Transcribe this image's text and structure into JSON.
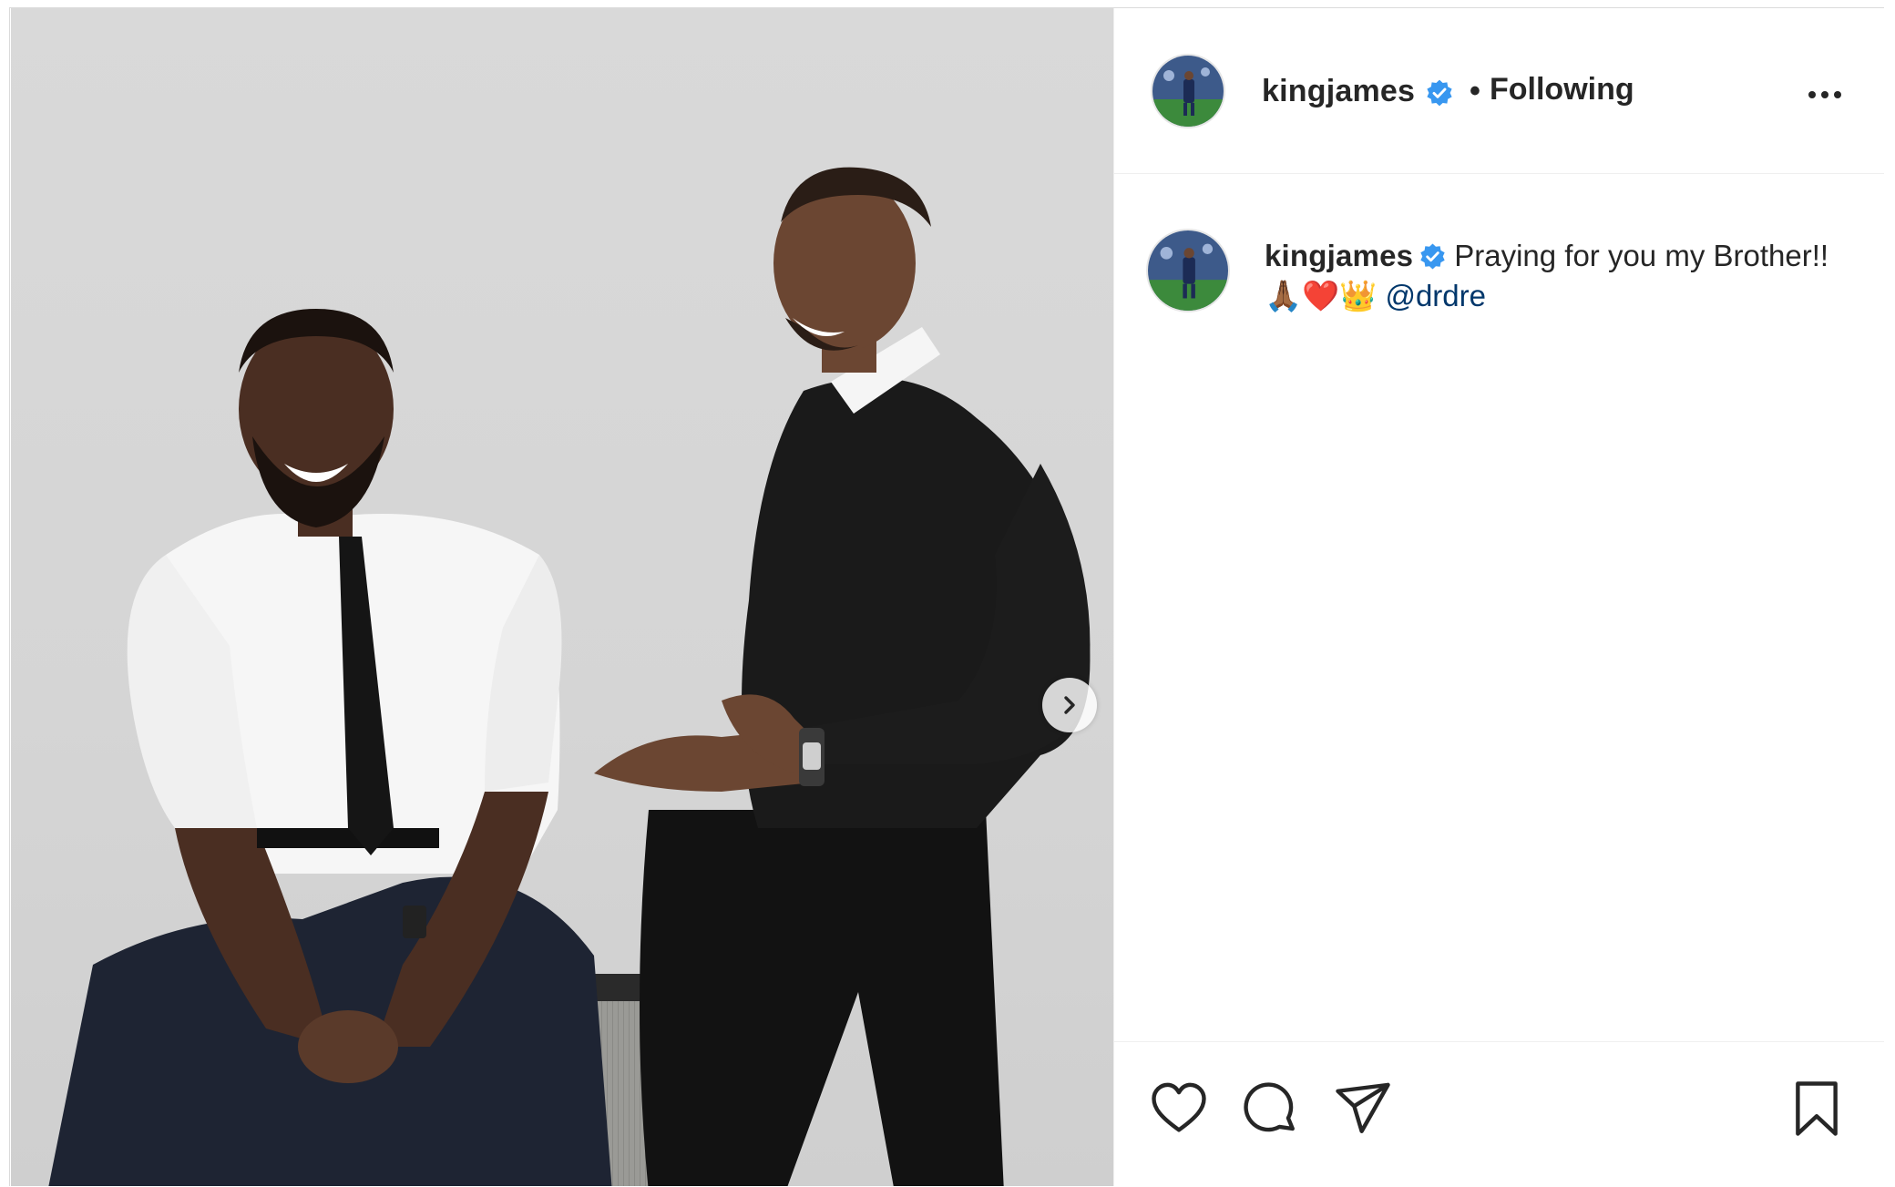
{
  "post": {
    "username": "kingjames",
    "verified": true,
    "separator": "•",
    "follow_status": "Following",
    "caption_text": "Praying for you my Brother!!",
    "caption_emoji": "🙏🏾❤️👑",
    "caption_mention": "@drdre"
  },
  "icons": {
    "verified": "verified-badge-icon",
    "more": "more-options-icon",
    "next": "chevron-right-icon",
    "like": "heart-icon",
    "comment": "comment-icon",
    "share": "paper-plane-icon",
    "save": "bookmark-icon"
  },
  "colors": {
    "verified_blue": "#3897f0",
    "mention_blue": "#00376b",
    "text": "#262626",
    "border": "#efefef"
  }
}
